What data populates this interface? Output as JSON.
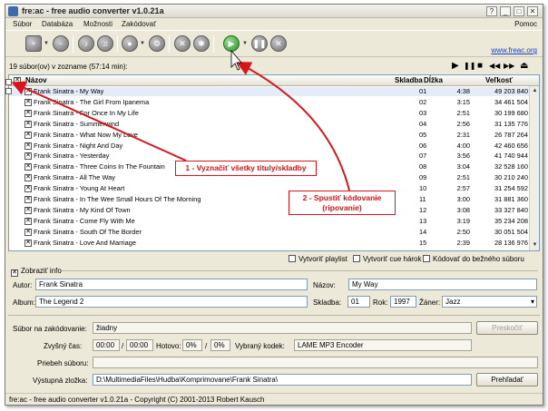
{
  "window": {
    "title": "fre:ac - free audio converter v1.0.21a",
    "controls": [
      "?",
      "_",
      "□",
      "✕"
    ]
  },
  "menu": {
    "items": [
      "Súbor",
      "Databáza",
      "Možnosti",
      "Zakódovať"
    ],
    "help": "Pomoc"
  },
  "toolbar": {
    "website_link": "www.freac.org",
    "icons": [
      "add-file-icon",
      "remove-icon",
      "cddb-query-icon",
      "cddb-submit-icon",
      "cd-drive-icon",
      "settings-icon",
      "tools-icon",
      "config-icon",
      "start-encoding-icon",
      "pause-icon",
      "stop-icon"
    ]
  },
  "joblist": {
    "summary": "19 súbor(ov) v zozname (57:14 min):",
    "transport": [
      "▶",
      "❚❚",
      "■",
      "◀◀",
      "▶▶",
      "⏏"
    ]
  },
  "table": {
    "headers": {
      "name": "Názov",
      "track": "Skladba",
      "length": "Dĺžka",
      "size": "Veľkosť"
    },
    "rows": [
      {
        "name": "Frank Sinatra - My Way",
        "track": "01",
        "length": "4:38",
        "size": "49 203 840"
      },
      {
        "name": "Frank Sinatra - The Girl From Ipanema",
        "track": "02",
        "length": "3:15",
        "size": "34 461 504"
      },
      {
        "name": "Frank Sinatra - For Once In My Life",
        "track": "03",
        "length": "2:51",
        "size": "30 199 680"
      },
      {
        "name": "Frank Sinatra - Summerwind",
        "track": "04",
        "length": "2:56",
        "size": "31 135 776"
      },
      {
        "name": "Frank Sinatra - What Now My Love",
        "track": "05",
        "length": "2:31",
        "size": "26 787 264"
      },
      {
        "name": "Frank Sinatra - Night And Day",
        "track": "06",
        "length": "4:00",
        "size": "42 460 656"
      },
      {
        "name": "Frank Sinatra - Yesterday",
        "track": "07",
        "length": "3:56",
        "size": "41 740 944"
      },
      {
        "name": "Frank Sinatra - Three Coins In The Fountain",
        "track": "08",
        "length": "3:04",
        "size": "32 528 160"
      },
      {
        "name": "Frank Sinatra - All The Way",
        "track": "09",
        "length": "2:51",
        "size": "30 210 240"
      },
      {
        "name": "Frank Sinatra - Young At Heart",
        "track": "10",
        "length": "2:57",
        "size": "31 254 592"
      },
      {
        "name": "Frank Sinatra - In The Wee Small Hours Of The Morning",
        "track": "11",
        "length": "3:00",
        "size": "31 881 360"
      },
      {
        "name": "Frank Sinatra - My Kind Of Town",
        "track": "12",
        "length": "3:08",
        "size": "33 327 840"
      },
      {
        "name": "Frank Sinatra - Come Fly With Me",
        "track": "13",
        "length": "3:19",
        "size": "35 234 208"
      },
      {
        "name": "Frank Sinatra - South Of The Border",
        "track": "14",
        "length": "2:50",
        "size": "30 051 504"
      },
      {
        "name": "Frank Sinatra - Love And Marriage",
        "track": "15",
        "length": "2:39",
        "size": "28 136 976"
      }
    ]
  },
  "options": {
    "playlist": "Vytvoriť playlist",
    "cuesheet": "Vytvoriť cue hárok",
    "single_file": "Kódovať do bežného súboru"
  },
  "info": {
    "toggle": "Zobraziť info",
    "artist_label": "Autor:",
    "artist": "Frank Sinatra",
    "title_label": "Názov:",
    "title": "My Way",
    "album_label": "Album:",
    "album": "The Legend 2",
    "track_label": "Skladba:",
    "track": "01",
    "year_label": "Rok:",
    "year": "1997",
    "genre_label": "Žáner:",
    "genre": "Jazz"
  },
  "encoding": {
    "file_label": "Súbor na zakódovanie:",
    "file": "žiadny",
    "skip_button": "Preskočiť",
    "time_left_label": "Zvyšný čas:",
    "time_left": "00:00",
    "time_sep": "/",
    "time_total": "00:00",
    "done_label": "Hotovo:",
    "done": "0%",
    "done_sep": "/",
    "done_total": "0%",
    "encoder_label": "Vybraný kodek:",
    "encoder": "LAME MP3 Encoder",
    "progress_label": "Priebeh súboru:",
    "progress": 0,
    "output_label": "Výstupná zložka:",
    "output": "D:\\MultimediaFiles\\Hudba\\Komprimovane\\Frank Sinatra\\",
    "browse_button": "Prehľadať"
  },
  "statusbar": {
    "text": "fre:ac - free audio converter v1.0.21a - Copyright (C) 2001-2013 Robert Kausch"
  },
  "annotations": {
    "step1": "1 - Vyznačiť všetky tituly/skladby",
    "step2_line1": "2 - Spustiť kódovanie",
    "step2_line2": "(ripovanie)",
    "color": "#d8151c"
  }
}
